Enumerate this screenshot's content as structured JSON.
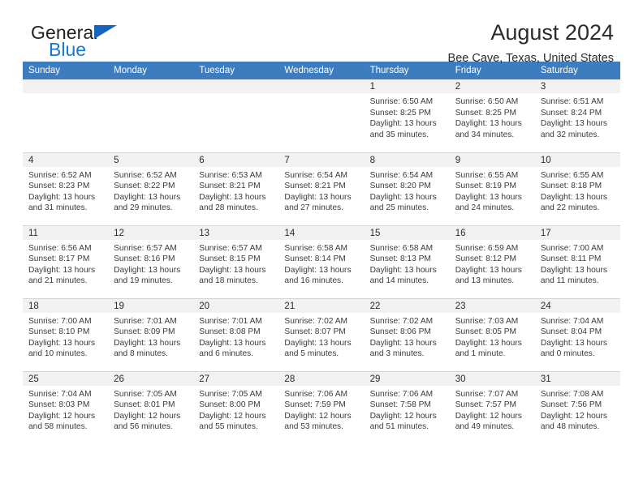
{
  "brand": {
    "name_part1": "General",
    "name_part2": "Blue",
    "flag_icon": "blue-triangle-flag-icon"
  },
  "header": {
    "title": "August 2024",
    "subtitle": "Bee Cave, Texas, United States"
  },
  "colors": {
    "header_row_background": "#3c7cbf",
    "header_row_text": "#ffffff",
    "daynum_band_background": "#f1f1f1",
    "brand_blue": "#1b76d2",
    "grid_line": "#d4d4d4"
  },
  "weekday_headers": [
    "Sunday",
    "Monday",
    "Tuesday",
    "Wednesday",
    "Thursday",
    "Friday",
    "Saturday"
  ],
  "weeks": [
    [
      {
        "day": "",
        "sunrise": "",
        "sunset": "",
        "daylight_line1": "",
        "daylight_line2": ""
      },
      {
        "day": "",
        "sunrise": "",
        "sunset": "",
        "daylight_line1": "",
        "daylight_line2": ""
      },
      {
        "day": "",
        "sunrise": "",
        "sunset": "",
        "daylight_line1": "",
        "daylight_line2": ""
      },
      {
        "day": "",
        "sunrise": "",
        "sunset": "",
        "daylight_line1": "",
        "daylight_line2": ""
      },
      {
        "day": "1",
        "sunrise": "Sunrise: 6:50 AM",
        "sunset": "Sunset: 8:25 PM",
        "daylight_line1": "Daylight: 13 hours",
        "daylight_line2": "and 35 minutes."
      },
      {
        "day": "2",
        "sunrise": "Sunrise: 6:50 AM",
        "sunset": "Sunset: 8:25 PM",
        "daylight_line1": "Daylight: 13 hours",
        "daylight_line2": "and 34 minutes."
      },
      {
        "day": "3",
        "sunrise": "Sunrise: 6:51 AM",
        "sunset": "Sunset: 8:24 PM",
        "daylight_line1": "Daylight: 13 hours",
        "daylight_line2": "and 32 minutes."
      }
    ],
    [
      {
        "day": "4",
        "sunrise": "Sunrise: 6:52 AM",
        "sunset": "Sunset: 8:23 PM",
        "daylight_line1": "Daylight: 13 hours",
        "daylight_line2": "and 31 minutes."
      },
      {
        "day": "5",
        "sunrise": "Sunrise: 6:52 AM",
        "sunset": "Sunset: 8:22 PM",
        "daylight_line1": "Daylight: 13 hours",
        "daylight_line2": "and 29 minutes."
      },
      {
        "day": "6",
        "sunrise": "Sunrise: 6:53 AM",
        "sunset": "Sunset: 8:21 PM",
        "daylight_line1": "Daylight: 13 hours",
        "daylight_line2": "and 28 minutes."
      },
      {
        "day": "7",
        "sunrise": "Sunrise: 6:54 AM",
        "sunset": "Sunset: 8:21 PM",
        "daylight_line1": "Daylight: 13 hours",
        "daylight_line2": "and 27 minutes."
      },
      {
        "day": "8",
        "sunrise": "Sunrise: 6:54 AM",
        "sunset": "Sunset: 8:20 PM",
        "daylight_line1": "Daylight: 13 hours",
        "daylight_line2": "and 25 minutes."
      },
      {
        "day": "9",
        "sunrise": "Sunrise: 6:55 AM",
        "sunset": "Sunset: 8:19 PM",
        "daylight_line1": "Daylight: 13 hours",
        "daylight_line2": "and 24 minutes."
      },
      {
        "day": "10",
        "sunrise": "Sunrise: 6:55 AM",
        "sunset": "Sunset: 8:18 PM",
        "daylight_line1": "Daylight: 13 hours",
        "daylight_line2": "and 22 minutes."
      }
    ],
    [
      {
        "day": "11",
        "sunrise": "Sunrise: 6:56 AM",
        "sunset": "Sunset: 8:17 PM",
        "daylight_line1": "Daylight: 13 hours",
        "daylight_line2": "and 21 minutes."
      },
      {
        "day": "12",
        "sunrise": "Sunrise: 6:57 AM",
        "sunset": "Sunset: 8:16 PM",
        "daylight_line1": "Daylight: 13 hours",
        "daylight_line2": "and 19 minutes."
      },
      {
        "day": "13",
        "sunrise": "Sunrise: 6:57 AM",
        "sunset": "Sunset: 8:15 PM",
        "daylight_line1": "Daylight: 13 hours",
        "daylight_line2": "and 18 minutes."
      },
      {
        "day": "14",
        "sunrise": "Sunrise: 6:58 AM",
        "sunset": "Sunset: 8:14 PM",
        "daylight_line1": "Daylight: 13 hours",
        "daylight_line2": "and 16 minutes."
      },
      {
        "day": "15",
        "sunrise": "Sunrise: 6:58 AM",
        "sunset": "Sunset: 8:13 PM",
        "daylight_line1": "Daylight: 13 hours",
        "daylight_line2": "and 14 minutes."
      },
      {
        "day": "16",
        "sunrise": "Sunrise: 6:59 AM",
        "sunset": "Sunset: 8:12 PM",
        "daylight_line1": "Daylight: 13 hours",
        "daylight_line2": "and 13 minutes."
      },
      {
        "day": "17",
        "sunrise": "Sunrise: 7:00 AM",
        "sunset": "Sunset: 8:11 PM",
        "daylight_line1": "Daylight: 13 hours",
        "daylight_line2": "and 11 minutes."
      }
    ],
    [
      {
        "day": "18",
        "sunrise": "Sunrise: 7:00 AM",
        "sunset": "Sunset: 8:10 PM",
        "daylight_line1": "Daylight: 13 hours",
        "daylight_line2": "and 10 minutes."
      },
      {
        "day": "19",
        "sunrise": "Sunrise: 7:01 AM",
        "sunset": "Sunset: 8:09 PM",
        "daylight_line1": "Daylight: 13 hours",
        "daylight_line2": "and 8 minutes."
      },
      {
        "day": "20",
        "sunrise": "Sunrise: 7:01 AM",
        "sunset": "Sunset: 8:08 PM",
        "daylight_line1": "Daylight: 13 hours",
        "daylight_line2": "and 6 minutes."
      },
      {
        "day": "21",
        "sunrise": "Sunrise: 7:02 AM",
        "sunset": "Sunset: 8:07 PM",
        "daylight_line1": "Daylight: 13 hours",
        "daylight_line2": "and 5 minutes."
      },
      {
        "day": "22",
        "sunrise": "Sunrise: 7:02 AM",
        "sunset": "Sunset: 8:06 PM",
        "daylight_line1": "Daylight: 13 hours",
        "daylight_line2": "and 3 minutes."
      },
      {
        "day": "23",
        "sunrise": "Sunrise: 7:03 AM",
        "sunset": "Sunset: 8:05 PM",
        "daylight_line1": "Daylight: 13 hours",
        "daylight_line2": "and 1 minute."
      },
      {
        "day": "24",
        "sunrise": "Sunrise: 7:04 AM",
        "sunset": "Sunset: 8:04 PM",
        "daylight_line1": "Daylight: 13 hours",
        "daylight_line2": "and 0 minutes."
      }
    ],
    [
      {
        "day": "25",
        "sunrise": "Sunrise: 7:04 AM",
        "sunset": "Sunset: 8:03 PM",
        "daylight_line1": "Daylight: 12 hours",
        "daylight_line2": "and 58 minutes."
      },
      {
        "day": "26",
        "sunrise": "Sunrise: 7:05 AM",
        "sunset": "Sunset: 8:01 PM",
        "daylight_line1": "Daylight: 12 hours",
        "daylight_line2": "and 56 minutes."
      },
      {
        "day": "27",
        "sunrise": "Sunrise: 7:05 AM",
        "sunset": "Sunset: 8:00 PM",
        "daylight_line1": "Daylight: 12 hours",
        "daylight_line2": "and 55 minutes."
      },
      {
        "day": "28",
        "sunrise": "Sunrise: 7:06 AM",
        "sunset": "Sunset: 7:59 PM",
        "daylight_line1": "Daylight: 12 hours",
        "daylight_line2": "and 53 minutes."
      },
      {
        "day": "29",
        "sunrise": "Sunrise: 7:06 AM",
        "sunset": "Sunset: 7:58 PM",
        "daylight_line1": "Daylight: 12 hours",
        "daylight_line2": "and 51 minutes."
      },
      {
        "day": "30",
        "sunrise": "Sunrise: 7:07 AM",
        "sunset": "Sunset: 7:57 PM",
        "daylight_line1": "Daylight: 12 hours",
        "daylight_line2": "and 49 minutes."
      },
      {
        "day": "31",
        "sunrise": "Sunrise: 7:08 AM",
        "sunset": "Sunset: 7:56 PM",
        "daylight_line1": "Daylight: 12 hours",
        "daylight_line2": "and 48 minutes."
      }
    ]
  ]
}
